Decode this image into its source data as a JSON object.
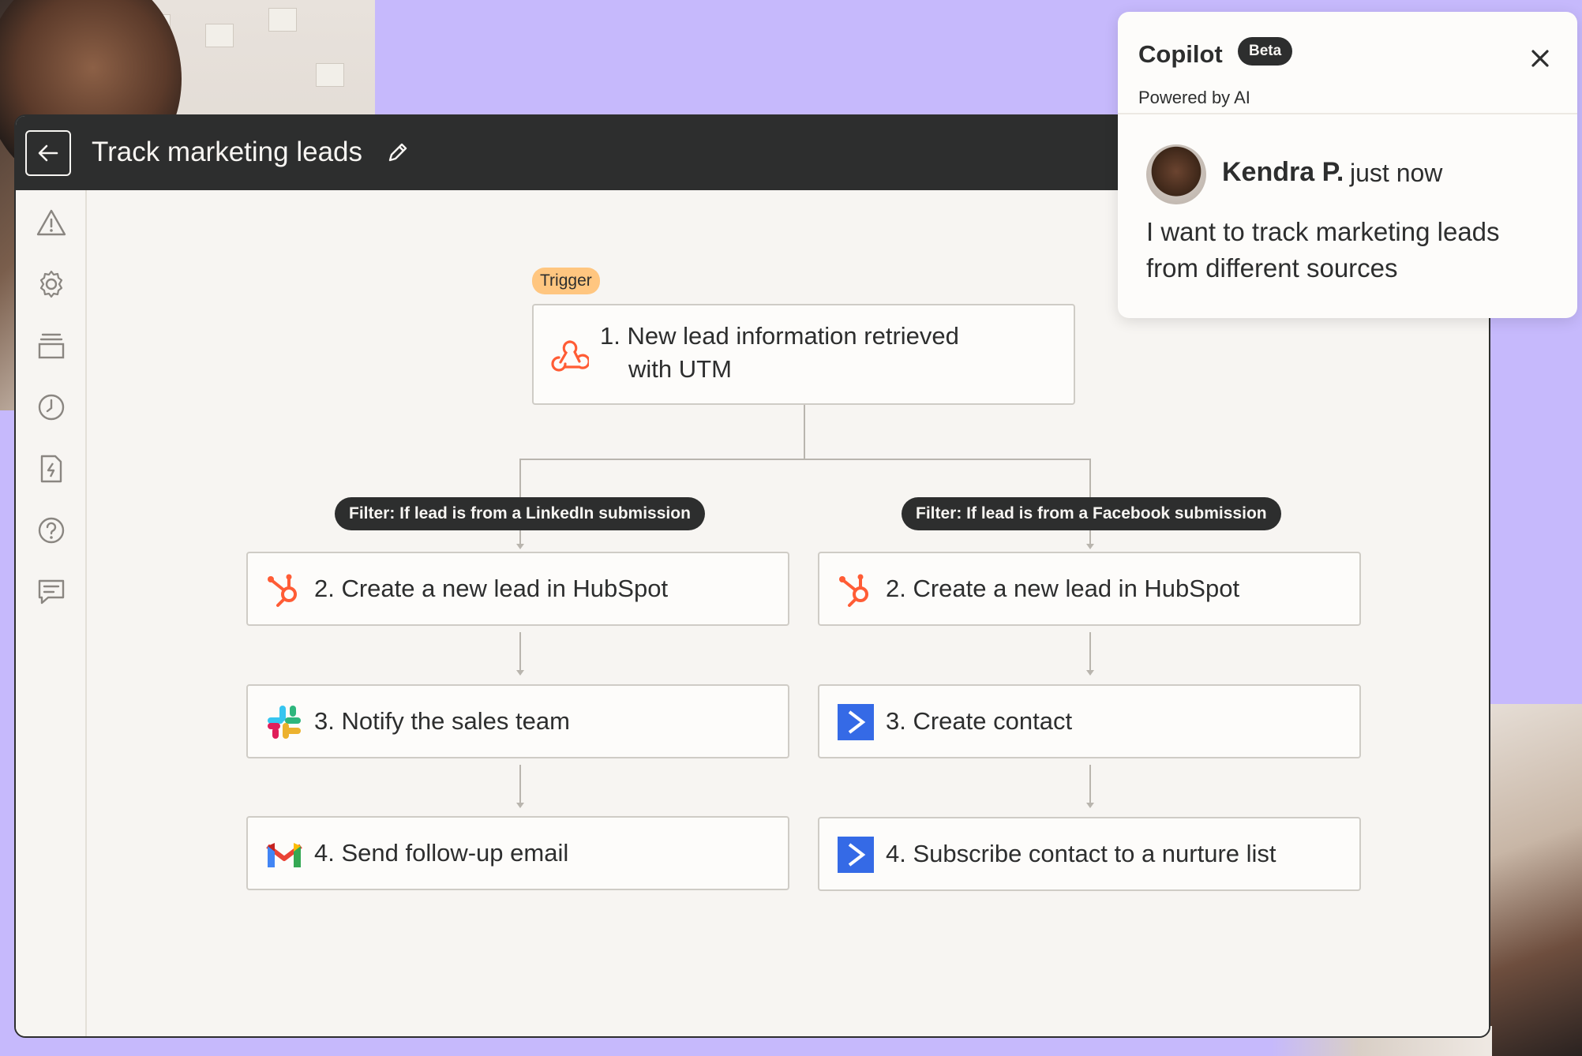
{
  "editor": {
    "title": "Track marketing leads"
  },
  "flow": {
    "trigger_badge": "Trigger",
    "trigger_step": {
      "line1": "1. New lead information retrieved",
      "line2": "with UTM"
    },
    "branches": [
      {
        "filter": "Filter: If lead is from a LinkedIn submission",
        "steps": [
          {
            "label": "2. Create a new lead in HubSpot",
            "icon": "hubspot-icon"
          },
          {
            "label": "3. Notify the sales team",
            "icon": "slack-icon"
          },
          {
            "label": "4. Send follow-up email",
            "icon": "gmail-icon"
          }
        ]
      },
      {
        "filter": "Filter: If lead is from a Facebook submission",
        "steps": [
          {
            "label": "2. Create a new lead in HubSpot",
            "icon": "hubspot-icon"
          },
          {
            "label": "3. Create contact",
            "icon": "activecampaign-icon"
          },
          {
            "label": "4. Subscribe contact to a nurture list",
            "icon": "activecampaign-icon"
          }
        ]
      }
    ]
  },
  "sidebar": {
    "icons": [
      "warning-icon",
      "settings-icon",
      "versions-icon",
      "history-icon",
      "zap-file-icon",
      "help-icon",
      "comments-icon"
    ]
  },
  "copilot": {
    "name": "Copilot",
    "badge": "Beta",
    "subtitle": "Powered by AI",
    "author": "Kendra P.",
    "time": "just now",
    "message": "I want to track marketing leads from different sources"
  },
  "colors": {
    "background": "#c6b9fc",
    "topbar": "#2d2e2e",
    "canvas": "#f7f5f2",
    "trigger_badge": "#ffc680",
    "hubspot": "#ff5c35",
    "activecampaign": "#356ae6"
  }
}
